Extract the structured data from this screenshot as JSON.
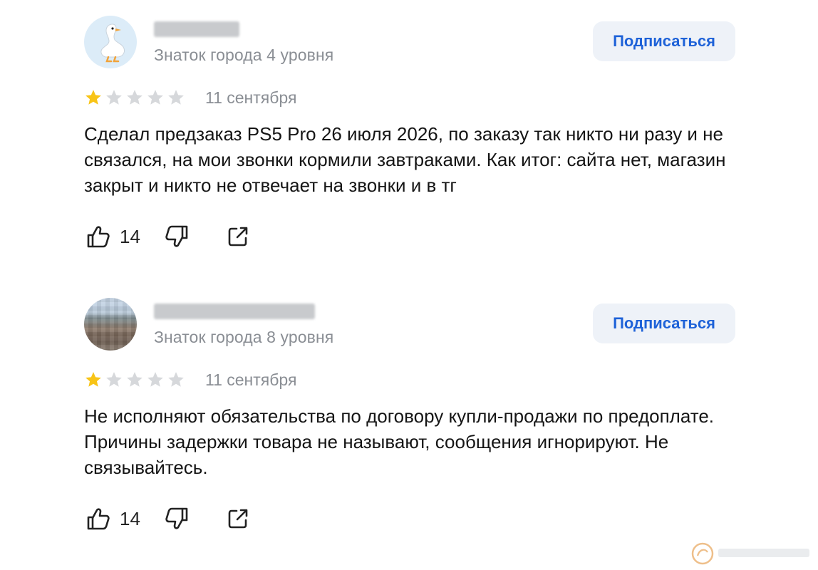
{
  "reviews": [
    {
      "avatar": "goose-avatar",
      "level": "Знаток города 4 уровня",
      "subscribe_label": "Подписаться",
      "rating": 1,
      "date": "11 сентября",
      "text": "Сделал предзаказ PS5 Pro 26 июля 2026, по заказу так никто ни разу и не связался, на мои звонки кормили завтраками. Как итог: сайта нет, магазин закрыт и никто не отвечает на звонки и в тг",
      "likes": "14"
    },
    {
      "avatar": "photo-avatar",
      "level": "Знаток города 8 уровня",
      "subscribe_label": "Подписаться",
      "rating": 1,
      "date": "11 сентября",
      "text": "Не исполняют обязательства по договору купли-продажи по предоплате. Причины задержки товара не называют, сообщения игнорируют. Не связывайтесь.",
      "likes": "14"
    }
  ],
  "colors": {
    "accent": "#1e62d8",
    "subscribe_bg": "#eef2f8",
    "star_active": "#f8c417",
    "star_inactive": "#d6d8db",
    "muted_text": "#8a8e94"
  }
}
